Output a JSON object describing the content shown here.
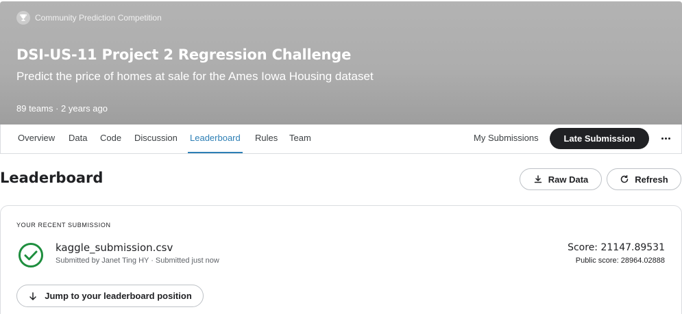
{
  "hero": {
    "type_label": "Community Prediction Competition",
    "title": "DSI-US-11 Project 2 Regression Challenge",
    "subtitle": "Predict the price of homes at sale for the Ames Iowa Housing dataset",
    "meta": "89 teams · 2 years ago",
    "icon": "trophy-icon"
  },
  "nav": {
    "tabs": [
      "Overview",
      "Data",
      "Code",
      "Discussion",
      "Leaderboard",
      "Rules",
      "Team"
    ],
    "active_tab": "Leaderboard",
    "my_submissions": "My Submissions",
    "late_submission": "Late Submission",
    "more_icon": "more-horizontal-icon"
  },
  "leaderboard": {
    "title": "Leaderboard",
    "raw_data_label": "Raw Data",
    "refresh_label": "Refresh"
  },
  "recent": {
    "section_label": "YOUR RECENT SUBMISSION",
    "filename": "kaggle_submission.csv",
    "submitted_by": "Submitted by Janet Ting HY · Submitted just now",
    "score": "Score: 21147.89531",
    "public_score": "Public score: 28964.02888",
    "jump_label": "Jump to your leaderboard position",
    "status_icon": "check-circle-icon"
  },
  "colors": {
    "accent": "#2d7fb5",
    "success": "#1e8e3e",
    "dark_button": "#202124",
    "hero_bg": "#adadad"
  }
}
